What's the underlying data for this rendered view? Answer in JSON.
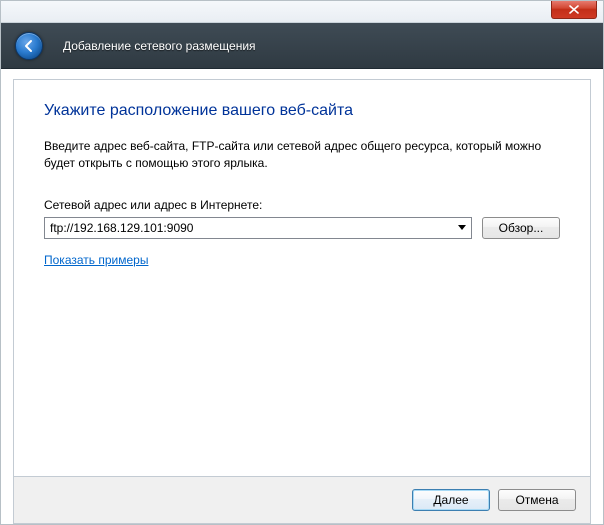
{
  "window_title": "Добавление сетевого размещения",
  "heading": "Укажите расположение вашего веб-сайта",
  "description": "Введите адрес веб-сайта, FTP-сайта или сетевой адрес общего ресурса, который можно будет открыть с помощью этого ярлыка.",
  "address_label": "Сетевой адрес или адрес в Интернете:",
  "address_value": "ftp://192.168.129.101:9090",
  "browse_label": "Обзор...",
  "examples_link": "Показать примеры",
  "next_label": "Далее",
  "cancel_label": "Отмена"
}
